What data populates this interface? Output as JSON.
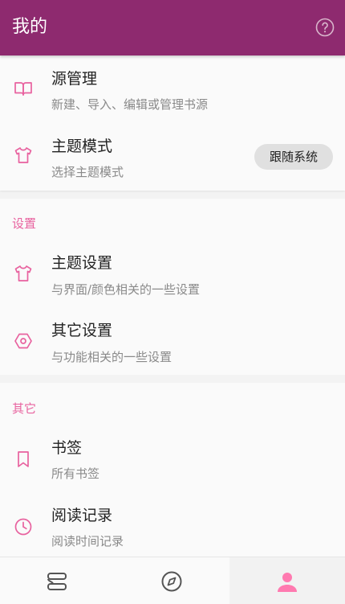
{
  "appbar": {
    "title": "我的",
    "help_icon": "help-circle-icon"
  },
  "section_main": {
    "items": [
      {
        "title": "源管理",
        "subtitle": "新建、导入、编辑或管理书源",
        "icon": "book-open-icon"
      },
      {
        "title": "主题模式",
        "subtitle": "选择主题模式",
        "icon": "shirt-icon",
        "chip": "跟随系统"
      }
    ]
  },
  "section_settings": {
    "header": "设置",
    "items": [
      {
        "title": "主题设置",
        "subtitle": "与界面/颜色相关的一些设置",
        "icon": "shirt-icon"
      },
      {
        "title": "其它设置",
        "subtitle": "与功能相关的一些设置",
        "icon": "settings-hex-icon"
      }
    ]
  },
  "section_other": {
    "header": "其它",
    "items": [
      {
        "title": "书签",
        "subtitle": "所有书签",
        "icon": "bookmark-icon"
      },
      {
        "title": "阅读记录",
        "subtitle": "阅读时间记录",
        "icon": "clock-icon"
      }
    ]
  },
  "bottom_nav": {
    "items": [
      {
        "icon": "bookshelf-icon",
        "active": false
      },
      {
        "icon": "compass-icon",
        "active": false
      },
      {
        "icon": "person-icon",
        "active": true
      }
    ]
  },
  "colors": {
    "appbar": "#8e2a6f",
    "accent": "#e8629f",
    "icon": "#e8629f"
  }
}
